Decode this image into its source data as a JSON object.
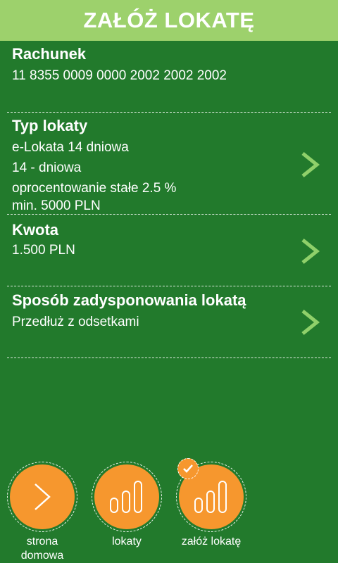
{
  "header": {
    "title": "ZAŁÓŻ LOKATĘ"
  },
  "account": {
    "title": "Rachunek",
    "number": "11 8355 0009 0000 2002 2002 2002"
  },
  "deposit_type": {
    "title": "Typ lokaty",
    "lines": [
      "e-Lokata 14 dniowa",
      "14 - dniowa",
      "oprocentowanie stałe 2.5 %",
      "min. 5000 PLN"
    ]
  },
  "amount": {
    "title": "Kwota",
    "value": "1.500 PLN"
  },
  "disposition": {
    "title": "Sposób zadysponowania lokatą",
    "value": "Przedłuż z odsetkami"
  },
  "nav": {
    "home_line1": "strona",
    "home_line2": "domowa",
    "deposits": "lokaty",
    "open_deposit": "załóż lokatę"
  },
  "colors": {
    "background": "#227a2c",
    "header": "#9dd16c",
    "accent": "#f6972e",
    "chevron": "#8fd06a"
  },
  "icons": [
    "chevron-right-icon",
    "arrow-right-icon",
    "bars-icon",
    "check-icon"
  ]
}
